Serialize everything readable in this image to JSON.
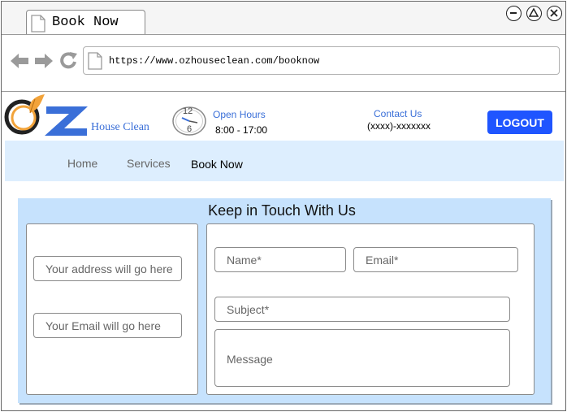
{
  "browser": {
    "tab_title": "Book Now",
    "url": "https://www.ozhouseclean.com/booknow"
  },
  "header": {
    "brand_name": "House Clean",
    "clock_12": "12",
    "clock_6": "6",
    "hours_title": "Open Hours",
    "hours_value": "8:00 - 17:00",
    "contact_title": "Contact Us",
    "contact_value": "(xxxx)-xxxxxxx",
    "logout_label": "LOGOUT"
  },
  "nav": {
    "items": [
      "Home",
      "Services",
      "Book Now"
    ],
    "active": "Book Now"
  },
  "contact_section": {
    "title": "Keep in Touch With Us",
    "address_placeholder": "Your address will go here",
    "email_info_placeholder": "Your Email will go here",
    "name_placeholder": "Name*",
    "email_placeholder": "Email*",
    "subject_placeholder": "Subject*",
    "message_placeholder": "Message"
  },
  "colors": {
    "logout_bg": "#1f55ff",
    "nav_bg": "#ddeefe",
    "panel_bg": "#c6e2fd",
    "link_blue": "#3a6fd8",
    "logo_orange": "#f2a33a",
    "logo_blue": "#3a6fd8"
  },
  "icons": [
    "page-icon",
    "back-icon",
    "forward-icon",
    "reload-icon",
    "minimize-icon",
    "maximize-icon",
    "close-icon",
    "clock-icon",
    "brand-logo"
  ]
}
